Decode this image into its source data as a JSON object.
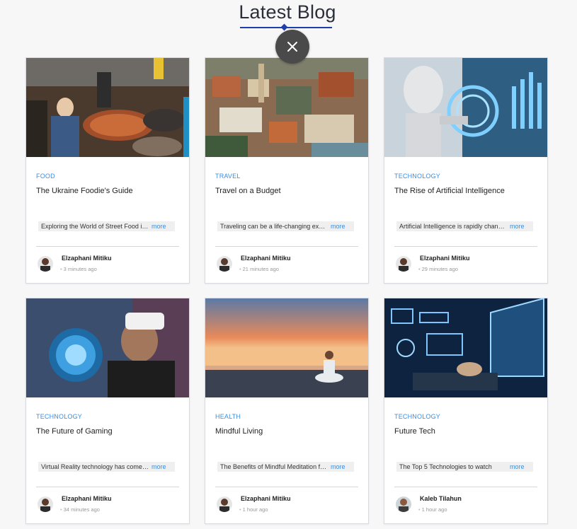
{
  "page": {
    "title": "Latest Blog"
  },
  "close_button": {
    "icon": "close-icon"
  },
  "posts": [
    {
      "image": "street-food-market-photo",
      "category": "FOOD",
      "title": "The Ukraine Foodie's Guide",
      "excerpt": "Exploring the World of Street Food in Ukraine",
      "more": "more",
      "author": "Elzaphani Mitiku",
      "time": "3 minutes ago"
    },
    {
      "image": "city-aerial-photo",
      "category": "TRAVEL",
      "title": "Travel on a Budget",
      "excerpt": "Traveling can be a life-changing experience",
      "more": "more",
      "author": "Elzaphani Mitiku",
      "time": "21 minutes ago"
    },
    {
      "image": "robot-ai-photo",
      "category": "TECHNOLOGY",
      "title": "The Rise of Artificial Intelligence",
      "excerpt": "Artificial Intelligence is rapidly changing the world",
      "more": "more",
      "author": "Elzaphani Mitiku",
      "time": "29 minutes ago"
    },
    {
      "image": "vr-headset-photo",
      "category": "TECHNOLOGY",
      "title": "The Future of Gaming",
      "excerpt": "Virtual Reality technology has come a long way",
      "more": "more",
      "author": "Elzaphani Mitiku",
      "time": "34 minutes ago"
    },
    {
      "image": "beach-meditation-photo",
      "category": "HEALTH",
      "title": "Mindful Living",
      "excerpt": "The Benefits of Mindful Meditation for everyday life",
      "more": "more",
      "author": "Elzaphani Mitiku",
      "time": "1 hour ago"
    },
    {
      "image": "laptop-tech-photo",
      "category": "TECHNOLOGY",
      "title": "Future Tech",
      "excerpt": "The Top 5 Technologies to watch",
      "more": "more",
      "author": "Kaleb Tilahun",
      "time": "1 hour ago"
    }
  ],
  "colors": {
    "accent": "#3b8de0",
    "title_underline": "#1e40af",
    "close_bg": "#4a4a4a"
  }
}
